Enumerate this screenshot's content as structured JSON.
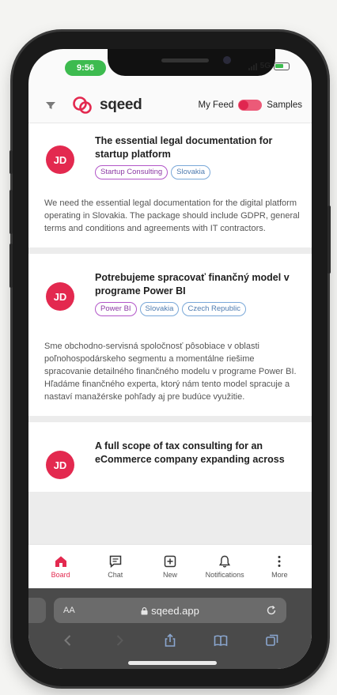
{
  "status": {
    "time": "9:56",
    "network": "5G"
  },
  "header": {
    "brand": "sqeed",
    "my_feed_label": "My Feed",
    "samples_label": "Samples"
  },
  "feed": [
    {
      "avatar": "JD",
      "title": "The essential legal documentation for startup platform",
      "tags": [
        {
          "label": "Startup Consulting",
          "style": "purple"
        },
        {
          "label": "Slovakia",
          "style": "blue"
        }
      ],
      "description": "We need the essential legal documentation for the digital platform operating in Slovakia. The package should include GDPR, general terms and conditions and agreements with IT contractors."
    },
    {
      "avatar": "JD",
      "title": "Potrebujeme spracovať finančný model v programe Power BI",
      "tags": [
        {
          "label": "Power BI",
          "style": "purple"
        },
        {
          "label": "Slovakia",
          "style": "blue"
        },
        {
          "label": "Czech Republic",
          "style": "blue"
        }
      ],
      "description": "Sme obchodno-servisná spoločnosť pôsobiace v oblasti poľnohospodárskeho segmentu a momentálne riešime spracovanie detailného finančného modelu v programe Power BI. Hľadáme finančného experta, ktorý nám tento model spracuje a nastaví manažérske pohľady aj pre budúce využitie."
    },
    {
      "avatar": "JD",
      "title": "A full scope of tax consulting for an eCommerce company expanding across",
      "tags": [],
      "description": ""
    }
  ],
  "tabbar": {
    "board": "Board",
    "chat": "Chat",
    "new": "New",
    "notifications": "Notifications",
    "more": "More"
  },
  "browser": {
    "aa": "AA",
    "url": "sqeed.app"
  },
  "colors": {
    "brand": "#e3294f",
    "tag_purple": "#b256c8",
    "tag_blue": "#7aa8d8"
  }
}
